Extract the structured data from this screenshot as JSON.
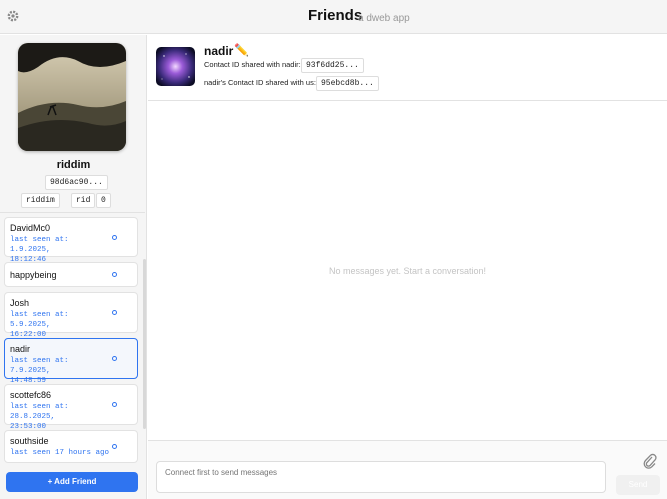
{
  "header": {
    "title": "Friends",
    "subtitle": "a dweb app",
    "settings_icon": "gear-icon"
  },
  "self": {
    "name": "riddim",
    "id_chip": "98d6ac90...",
    "tags": [
      "riddim",
      "rid",
      "0"
    ]
  },
  "friends": [
    {
      "name": "DavidMc0",
      "seen_line1": "last seen at: 1.9.2025,",
      "seen_line2": "18:12:46"
    },
    {
      "name": "happybeing",
      "seen_line1": "",
      "seen_line2": ""
    },
    {
      "name": "Josh",
      "seen_line1": "last seen at: 5.9.2025,",
      "seen_line2": "16:22:00"
    },
    {
      "name": "nadir",
      "seen_line1": "last seen at: 7.9.2025,",
      "seen_line2": "14:48:59"
    },
    {
      "name": "scottefc86",
      "seen_line1": "last seen at: 28.8.2025,",
      "seen_line2": "23:53:00"
    },
    {
      "name": "southside",
      "seen_line1": "last seen 17 hours ago",
      "seen_line2": ""
    }
  ],
  "add_friend_label": "+ Add Friend",
  "contact": {
    "name": "nadir",
    "emoji": "✏️",
    "shared_label": "Contact ID shared with nadir:",
    "shared_id": "93f6dd25...",
    "received_label": "nadir's Contact ID shared with us:",
    "received_id": "95ebcd8b..."
  },
  "messages_empty": "No messages yet. Start a conversation!",
  "composer": {
    "placeholder": "Connect first to send messages",
    "send_label": "Send"
  },
  "colors": {
    "accent": "#2f74f0"
  }
}
